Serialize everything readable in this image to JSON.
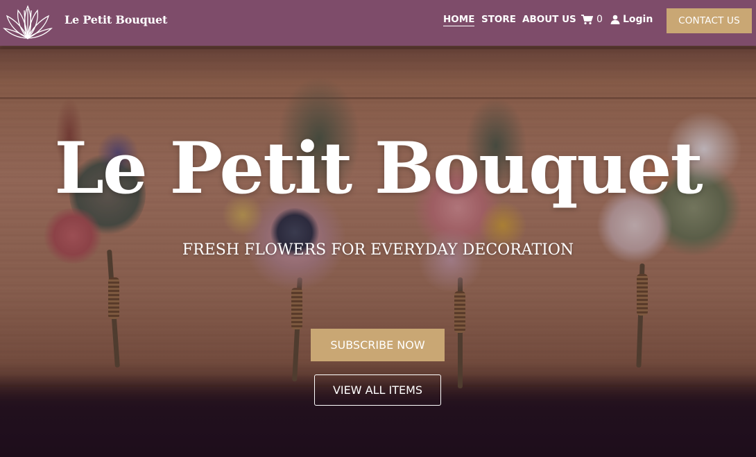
{
  "nav": {
    "brand": "Le Petit Bouquet",
    "links": [
      "HOME",
      "STORE",
      "ABOUT US"
    ],
    "cart_count": "0",
    "login_label": "Login",
    "contact_label": "CONTACT US"
  },
  "hero": {
    "title": "Le Petit Bouquet",
    "subtitle": "FRESH FLOWERS FOR EVERYDAY DECORATION",
    "subscribe_label": "SUBSCRIBE NOW",
    "view_all_label": "VIEW ALL ITEMS"
  },
  "colors": {
    "navbar": "#7e4c6a",
    "accent_gold": "#c9a774",
    "text_white": "#ffffff"
  },
  "icons": {
    "logo": "lotus-logo-icon",
    "cart": "shopping-cart-icon",
    "login": "user-icon"
  }
}
